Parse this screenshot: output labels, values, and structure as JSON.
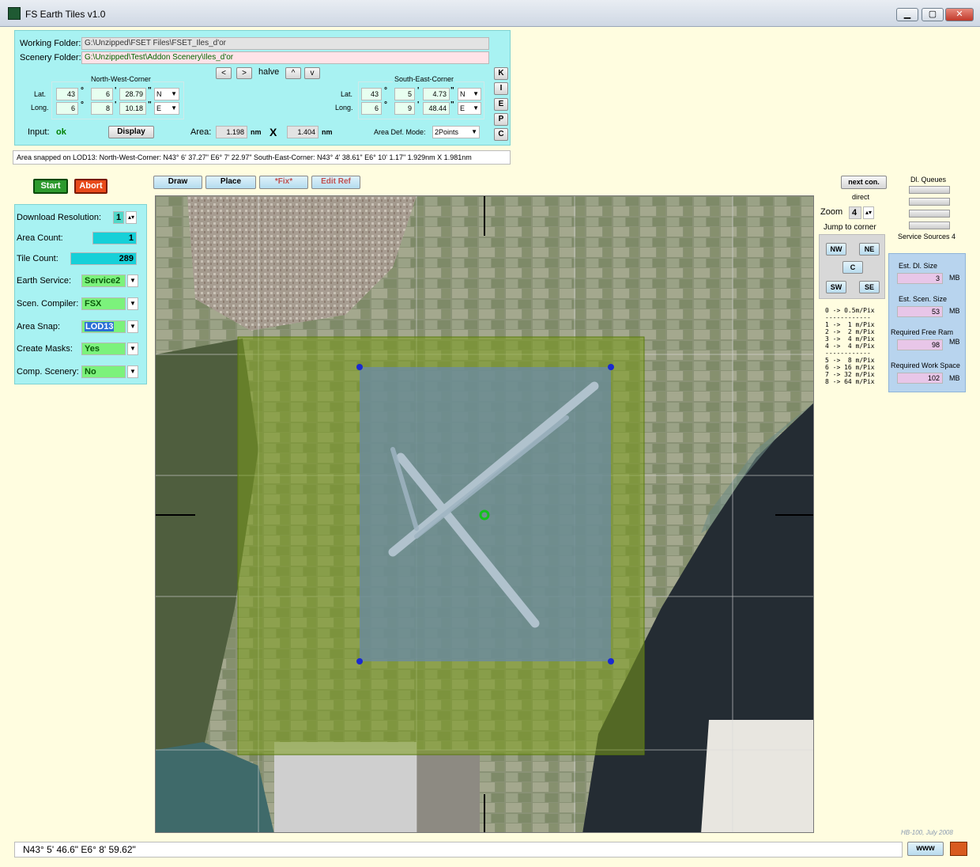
{
  "window": {
    "title": "FS Earth Tiles   v1.0",
    "min": "▁",
    "max": "▢",
    "close": "✕"
  },
  "folders": {
    "working_label": "Working Folder:",
    "working_value": "G:\\Unzipped\\FSET Files\\FSET_Iles_d'or",
    "scenery_label": "Scenery Folder:",
    "scenery_value": "G:\\Unzipped\\Test\\Addon Scenery\\Iles_d'or"
  },
  "nav": {
    "left": "<",
    "right": ">",
    "halve": "halve",
    "up": "^",
    "down": "v"
  },
  "nw": {
    "title": "North-West-Corner",
    "lat_label": "Lat.",
    "long_label": "Long.",
    "lat_deg": "43",
    "lat_min": "6",
    "lat_sec": "28.79",
    "lat_dir": "N",
    "long_deg": "6",
    "long_min": "8",
    "long_sec": "10.18",
    "long_dir": "E"
  },
  "se": {
    "title": "South-East-Corner",
    "lat_label": "Lat.",
    "long_label": "Long.",
    "lat_deg": "43",
    "lat_min": "5",
    "lat_sec": "4.73",
    "lat_dir": "N",
    "long_deg": "6",
    "long_min": "9",
    "long_sec": "48.44",
    "long_dir": "E"
  },
  "side_buttons": [
    "K",
    "I",
    "E",
    "P",
    "C"
  ],
  "input": {
    "label": "Input:",
    "status": "ok",
    "display": "Display",
    "area_label": "Area:",
    "area_w": "1.198",
    "unit": "nm",
    "times": "X",
    "area_h": "1.404",
    "mode_label": "Area Def. Mode:",
    "mode_value": "2Points"
  },
  "status_text": "Area snapped on LOD13:   North-West-Corner: N43° 6' 37.27\"   E6° 7' 22.97\"    South-East-Corner: N43° 4' 38.61\"   E6° 10' 1.17\"    1.929nm X 1.981nm",
  "actions": {
    "start": "Start",
    "abort": "Abort"
  },
  "toolbar": {
    "draw": "Draw",
    "place": "Place",
    "fix": "*Fix*",
    "edit_ref": "Edit Ref"
  },
  "settings": {
    "resolution_label": "Download Resolution:",
    "resolution_value": "1",
    "area_count_label": "Area Count:",
    "area_count_value": "1",
    "tile_count_label": "Tile Count:",
    "tile_count_value": "289",
    "earth_service_label": "Earth Service:",
    "earth_service_value": "Service2",
    "compiler_label": "Scen. Compiler:",
    "compiler_value": "FSX",
    "area_snap_label": "Area Snap:",
    "area_snap_value": "LOD13",
    "masks_label": "Create Masks:",
    "masks_value": "Yes",
    "comp_label": "Comp. Scenery:",
    "comp_value": "No"
  },
  "right": {
    "next_con": "next con.",
    "direct": "direct",
    "queues_title": "Dl. Queues",
    "service_sources": "Service Sources 4",
    "zoom_label": "Zoom",
    "zoom_value": "4",
    "jump_label": "Jump to corner",
    "nw": "NW",
    "ne": "NE",
    "c": "C",
    "sw": "SW",
    "se": "SE",
    "zoom_legend": "0 -> 0.5m/Pix\n------------\n1 ->  1 m/Pix\n2 ->  2 m/Pix\n3 ->  4 m/Pix\n4 ->  4 m/Pix\n------------\n5 ->  8 m/Pix\n6 -> 16 m/Pix\n7 -> 32 m/Pix\n8 -> 64 m/Pix",
    "est_dl_label": "Est. Dl. Size",
    "est_dl_value": "3",
    "est_scen_label": "Est. Scen. Size",
    "est_scen_value": "53",
    "free_ram_label": "Required Free Ram",
    "free_ram_value": "98",
    "work_space_label": "Required Work Space",
    "work_space_value": "102",
    "mb": "MB"
  },
  "footer": {
    "coords": "N43° 5' 46.6\"    E6° 8' 59.62\"",
    "www": "www",
    "credit": "HB-100,  July 2008"
  },
  "colors": {
    "panel": "#a8f2f2",
    "start": "#2e9a2e",
    "abort": "#e84a1a",
    "outer_area": "#7a9a1a",
    "inner_area": "#6a8aa8"
  }
}
